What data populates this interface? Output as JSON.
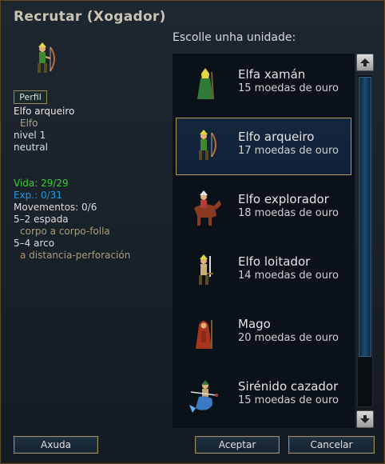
{
  "window": {
    "title": "Recrutar (Xogador)"
  },
  "left_panel": {
    "profile_button": "Perfil",
    "unit_type": "Elfo arqueiro",
    "race": "Elfo",
    "level": "nivel 1",
    "alignment": "neutral",
    "hp": "Vida: 29/29",
    "xp": "Exp.: 0/31",
    "moves": "Movementos: 0/6",
    "attacks": [
      {
        "name": "5–2 espada",
        "detail": "corpo a corpo-folla"
      },
      {
        "name": "5–4 arco",
        "detail": "a distancia-perforación"
      }
    ]
  },
  "list": {
    "heading": "Escolle unha unidade:",
    "units": [
      {
        "name": "Elfa xamán",
        "cost": "15 moedas de ouro",
        "icon": "elvish-shaman-icon"
      },
      {
        "name": "Elfo arqueiro",
        "cost": "17 moedas de ouro",
        "icon": "elvish-archer-icon",
        "selected": true
      },
      {
        "name": "Elfo explorador",
        "cost": "18 moedas de ouro",
        "icon": "elvish-scout-icon"
      },
      {
        "name": "Elfo loitador",
        "cost": "14 moedas de ouro",
        "icon": "elvish-fighter-icon"
      },
      {
        "name": "Mago",
        "cost": "20 moedas de ouro",
        "icon": "mage-icon"
      },
      {
        "name": "Sirénido cazador",
        "cost": "15 moedas de ouro",
        "icon": "merman-hunter-icon"
      }
    ]
  },
  "buttons": {
    "help": "Axuda",
    "ok": "Aceptar",
    "cancel": "Cancelar"
  },
  "colors": {
    "hp": "#35d035",
    "xp": "#1b9ce8",
    "selection_border": "#b79a5a"
  }
}
